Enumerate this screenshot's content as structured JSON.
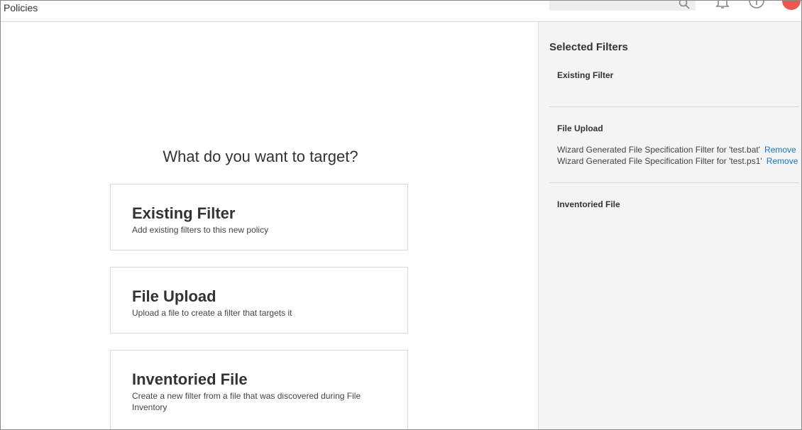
{
  "header": {
    "app_title": "Policies"
  },
  "main": {
    "question": "What do you want to target?",
    "cards": [
      {
        "title": "Existing Filter",
        "description": "Add existing filters to this new policy"
      },
      {
        "title": "File Upload",
        "description": "Upload a file to create a filter that targets it"
      },
      {
        "title": "Inventoried File",
        "description": "Create a new filter from a file that was discovered during File Inventory"
      }
    ]
  },
  "sidebar": {
    "heading": "Selected Filters",
    "sections": [
      {
        "title": "Existing Filter",
        "items": []
      },
      {
        "title": "File Upload",
        "items": [
          {
            "label": "Wizard Generated File Specification Filter for 'test.bat'",
            "action": "Remove"
          },
          {
            "label": "Wizard Generated File Specification Filter for 'test.ps1'",
            "action": "Remove"
          }
        ]
      },
      {
        "title": "Inventoried File",
        "items": []
      }
    ]
  },
  "icons": [
    "search-icon",
    "bell-icon",
    "help-icon",
    "avatar"
  ],
  "colors": {
    "link": "#1a73c8",
    "avatar": "#ea5a4e",
    "sidebar_bg": "#f4f4f4"
  }
}
